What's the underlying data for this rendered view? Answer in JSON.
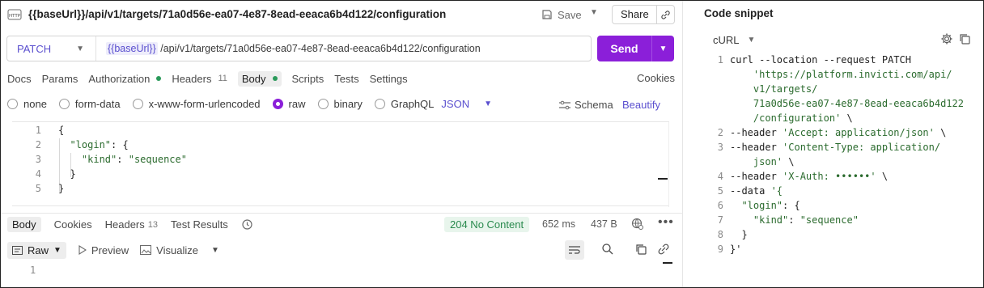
{
  "request": {
    "title": "{{baseUrl}}/api/v1/targets/71a0d56e-ea07-4e87-8ead-eeaca6b4d122/configuration",
    "save_label": "Save",
    "share_label": "Share",
    "method": "PATCH",
    "url_var": "{{baseUrl}}",
    "url_path": " /api/v1/targets/71a0d56e-ea07-4e87-8ead-eeaca6b4d122/configuration",
    "send_label": "Send"
  },
  "req_tabs": [
    {
      "label": "Docs"
    },
    {
      "label": "Params"
    },
    {
      "label": "Authorization"
    },
    {
      "label": "Headers",
      "count": "11"
    },
    {
      "label": "Body"
    },
    {
      "label": "Scripts"
    },
    {
      "label": "Tests"
    },
    {
      "label": "Settings"
    }
  ],
  "cookies_label": "Cookies",
  "body_types": [
    "none",
    "form-data",
    "x-www-form-urlencoded",
    "raw",
    "binary",
    "GraphQL"
  ],
  "body_format": "JSON",
  "schema_label": "Schema",
  "beautify_label": "Beautify",
  "editor_lines": [
    {
      "n": "1",
      "text": "{"
    },
    {
      "n": "2",
      "text": "  \"login\": {"
    },
    {
      "n": "3",
      "text": "    \"kind\": \"sequence\""
    },
    {
      "n": "4",
      "text": "  }"
    },
    {
      "n": "5",
      "text": "}"
    }
  ],
  "response": {
    "tabs": [
      {
        "label": "Body"
      },
      {
        "label": "Cookies"
      },
      {
        "label": "Headers",
        "count": "13"
      },
      {
        "label": "Test Results"
      }
    ],
    "status": "204 No Content",
    "time": "652 ms",
    "size": "437 B",
    "view_raw": "Raw",
    "view_preview": "Preview",
    "view_visualize": "Visualize",
    "line_no": "1"
  },
  "snippet": {
    "title": "Code snippet",
    "language": "cURL",
    "lines": [
      {
        "n": "1",
        "parts": [
          {
            "t": "curl --location --request PATCH",
            "c": "p"
          }
        ]
      },
      {
        "n": "",
        "parts": [
          {
            "t": "    'https://platform.invicti.com/api/",
            "c": "s"
          }
        ]
      },
      {
        "n": "",
        "parts": [
          {
            "t": "    v1/targets/",
            "c": "s"
          }
        ]
      },
      {
        "n": "",
        "parts": [
          {
            "t": "    71a0d56e-ea07-4e87-8ead-eeaca6b4d122",
            "c": "s"
          }
        ]
      },
      {
        "n": "",
        "parts": [
          {
            "t": "    /configuration'",
            "c": "s"
          },
          {
            "t": " \\",
            "c": "p"
          }
        ]
      },
      {
        "n": "2",
        "parts": [
          {
            "t": "--header ",
            "c": "p"
          },
          {
            "t": "'Accept: application/json'",
            "c": "s"
          },
          {
            "t": " \\",
            "c": "p"
          }
        ]
      },
      {
        "n": "3",
        "parts": [
          {
            "t": "--header ",
            "c": "p"
          },
          {
            "t": "'Content-Type: application/",
            "c": "s"
          }
        ]
      },
      {
        "n": "",
        "parts": [
          {
            "t": "    json'",
            "c": "s"
          },
          {
            "t": " \\",
            "c": "p"
          }
        ]
      },
      {
        "n": "4",
        "parts": [
          {
            "t": "--header ",
            "c": "p"
          },
          {
            "t": "'X-Auth: ••••••'",
            "c": "s"
          },
          {
            "t": " \\",
            "c": "p"
          }
        ]
      },
      {
        "n": "5",
        "parts": [
          {
            "t": "--data ",
            "c": "p"
          },
          {
            "t": "'{",
            "c": "s"
          }
        ]
      },
      {
        "n": "6",
        "parts": [
          {
            "t": "  \"login\"",
            "c": "s"
          },
          {
            "t": ": {",
            "c": "p"
          }
        ]
      },
      {
        "n": "7",
        "parts": [
          {
            "t": "    \"kind\"",
            "c": "s"
          },
          {
            "t": ": ",
            "c": "p"
          },
          {
            "t": "\"sequence\"",
            "c": "s"
          }
        ]
      },
      {
        "n": "8",
        "parts": [
          {
            "t": "  }",
            "c": "p"
          }
        ]
      },
      {
        "n": "9",
        "parts": [
          {
            "t": "}'",
            "c": "p"
          }
        ]
      }
    ]
  },
  "colors": {
    "accent": "#8b1fd9",
    "variable": "#5a4fcf",
    "status_ok": "#2a8a4e"
  }
}
